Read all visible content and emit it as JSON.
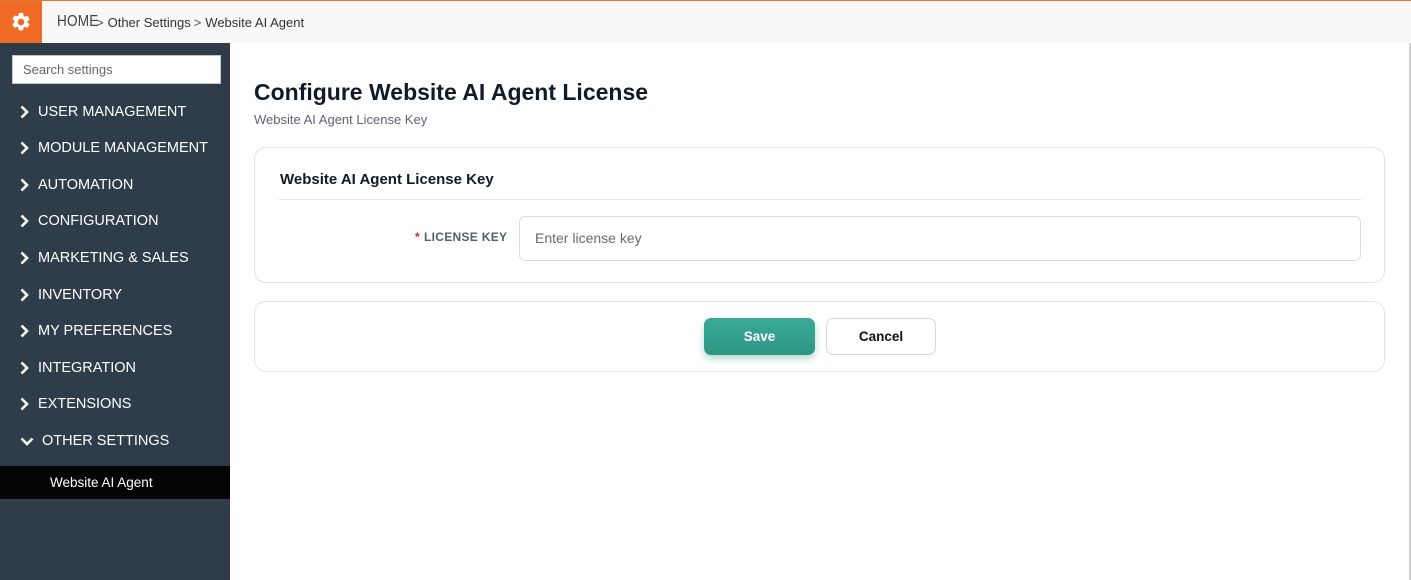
{
  "colors": {
    "accent_orange": "#ee6a25",
    "sidebar_bg": "#2f3d4a",
    "active_item_bg": "#050505",
    "save_green": "#339f8c",
    "required_red": "#c62828"
  },
  "header": {
    "gear_icon": "gear-icon",
    "breadcrumb": {
      "home": "HOME",
      "level1": "Other Settings",
      "level2": "Website AI Agent",
      "separator": ">"
    }
  },
  "sidebar": {
    "search_placeholder": "Search settings",
    "items": [
      {
        "label": "USER MANAGEMENT",
        "icon": "chevron-right-icon"
      },
      {
        "label": "MODULE MANAGEMENT",
        "icon": "chevron-right-icon"
      },
      {
        "label": "AUTOMATION",
        "icon": "chevron-right-icon"
      },
      {
        "label": "CONFIGURATION",
        "icon": "chevron-right-icon"
      },
      {
        "label": "MARKETING & SALES",
        "icon": "chevron-right-icon"
      },
      {
        "label": "INVENTORY",
        "icon": "chevron-right-icon"
      },
      {
        "label": "MY PREFERENCES",
        "icon": "chevron-right-icon"
      },
      {
        "label": "INTEGRATION",
        "icon": "chevron-right-icon"
      },
      {
        "label": "EXTENSIONS",
        "icon": "chevron-right-icon"
      },
      {
        "label": "OTHER SETTINGS",
        "icon": "chevron-down-icon"
      }
    ],
    "sub_item": "Website AI Agent"
  },
  "main": {
    "title": "Configure Website AI Agent License",
    "subtitle": "Website AI Agent License Key",
    "card_title": "Website AI Agent License Key",
    "field": {
      "required_mark": "*",
      "label": "LICENSE KEY",
      "placeholder": "Enter license key",
      "value": ""
    },
    "buttons": {
      "save": "Save",
      "cancel": "Cancel"
    }
  }
}
